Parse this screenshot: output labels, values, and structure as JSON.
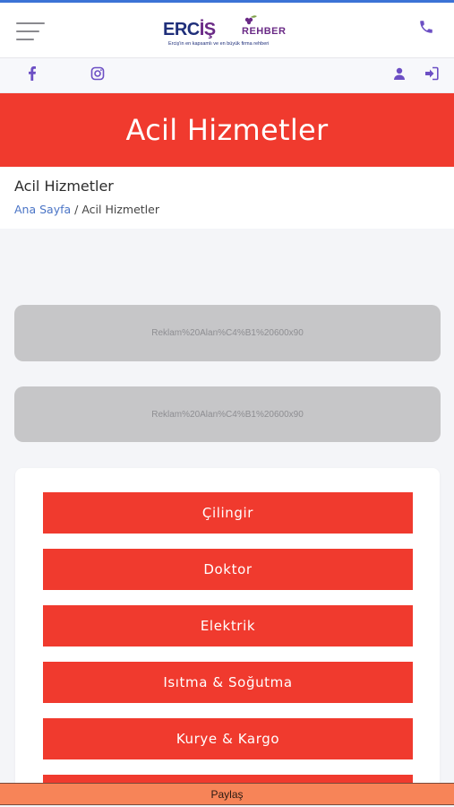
{
  "header": {
    "logo": {
      "word_part1": "ERC",
      "word_part2": "İŞ",
      "word_rehber": "REHBER",
      "tagline": "Erciş'in en kapsamlı ve en büyük firma rehberi"
    }
  },
  "hero": {
    "title": "Acil Hizmetler"
  },
  "breadcrumb": {
    "title": "Acil Hizmetler",
    "home": "Ana Sayfa",
    "separator": " / ",
    "current": "Acil Hizmetler"
  },
  "ads": [
    {
      "text": "Reklam%20Alan%C4%B1%20600x90"
    },
    {
      "text": "Reklam%20Alan%C4%B1%20600x90"
    }
  ],
  "services": [
    {
      "label": "Çilingir"
    },
    {
      "label": "Doktor"
    },
    {
      "label": "Elektrik"
    },
    {
      "label": "Isıtma & Soğutma"
    },
    {
      "label": "Kurye & Kargo"
    },
    {
      "label": ""
    }
  ],
  "share": {
    "label": "Paylaş"
  },
  "colors": {
    "accent_red": "#f03a2e",
    "icon_purple": "#6c4fc4",
    "share_orange": "#f78458",
    "link_blue": "#4a74c6"
  },
  "icons": [
    "menu-icon",
    "phone-icon",
    "facebook-icon",
    "instagram-icon",
    "user-icon",
    "sign-in-icon"
  ]
}
